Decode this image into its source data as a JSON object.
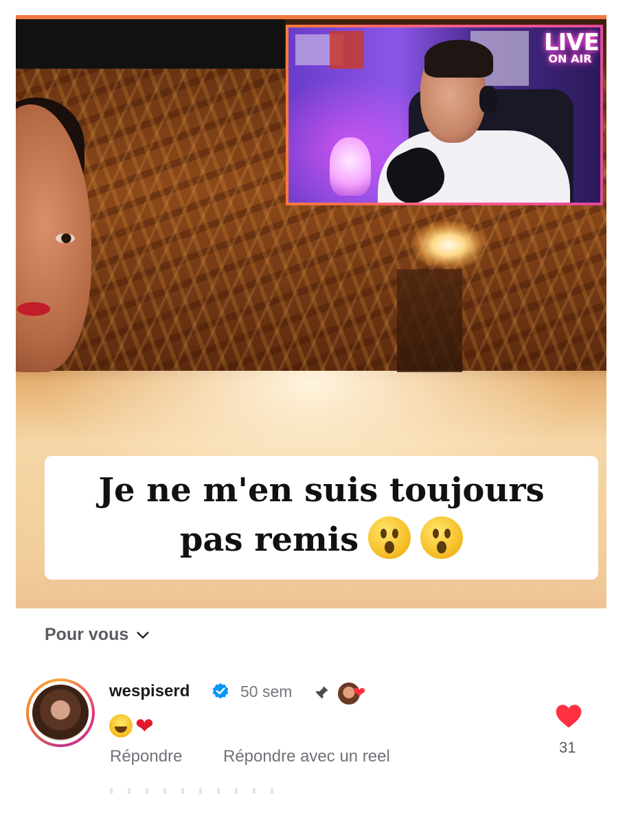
{
  "video": {
    "pip_badge": {
      "line1": "LIVE",
      "line2": "ON AIR"
    },
    "caption": {
      "line1": "Je ne m'en suis toujours",
      "line2": "pas remis"
    },
    "caption_emojis": [
      "astonished-face",
      "astonished-face"
    ]
  },
  "feed": {
    "for_you_label": "Pour vous"
  },
  "comment": {
    "username": "wespiserd",
    "verified": true,
    "time": "50 sem",
    "pinned": true,
    "liked_by_creator": true,
    "emojis": [
      "face-with-tears-of-joy",
      "red-heart"
    ],
    "reply_label": "Répondre",
    "reply_reel_label": "Répondre avec un reel",
    "like_count": "31"
  },
  "colors": {
    "like_red": "#ff3040",
    "verified_blue": "#0095f6",
    "live_pink": "#ff4fd8",
    "accent_orange": "#f07a43"
  }
}
